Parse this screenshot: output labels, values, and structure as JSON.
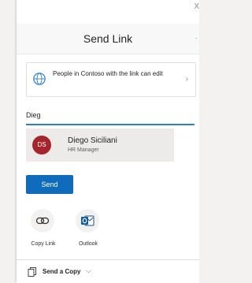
{
  "dialog": {
    "title": "Send Link",
    "close_glyph": "X",
    "more_glyph": "·"
  },
  "permission": {
    "icon": "globe-icon",
    "text": "People in Contoso with the link can edit",
    "chevron": "›"
  },
  "recipient": {
    "value": "Dieg"
  },
  "suggestion": {
    "initials": "DS",
    "name": "Diego Siciliani",
    "role": "HR Manager",
    "avatar_color": "#a4262c"
  },
  "actions": {
    "send_label": "Send",
    "send_color": "#0f6cbd"
  },
  "share_options": [
    {
      "label": "Copy Link",
      "icon": "link-icon"
    },
    {
      "label": "Outlook",
      "icon": "outlook-icon"
    }
  ],
  "footer": {
    "send_copy_label": "Send a Copy",
    "chevron": "⌵"
  }
}
